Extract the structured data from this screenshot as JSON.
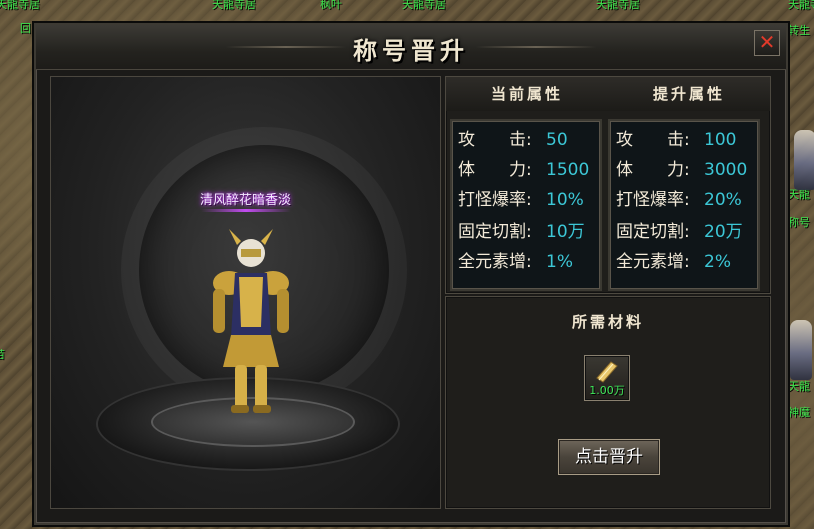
{
  "background": {
    "names": [
      "天龍寺居",
      "天龍寺居",
      "枫叶",
      "天龍寺居",
      "天龍寺居",
      "天龍寺居",
      "转生",
      "天龍",
      "称号",
      "天龍",
      "神魔",
      "回",
      "苗"
    ]
  },
  "window": {
    "title": "称号晋升",
    "close_icon": "close-x-icon"
  },
  "preview": {
    "character_title": "清风醉花暗香淡"
  },
  "current_attrs": {
    "header": "当前属性",
    "rows": [
      {
        "label": "攻　　击:",
        "value": "50"
      },
      {
        "label": "体　　力:",
        "value": "1500"
      },
      {
        "label": "打怪爆率:",
        "value": "10%"
      },
      {
        "label": "固定切割:",
        "value": "10万"
      },
      {
        "label": "全元素增:",
        "value": "1%"
      }
    ]
  },
  "upgrade_attrs": {
    "header": "提升属性",
    "rows": [
      {
        "label": "攻　　击:",
        "value": "100"
      },
      {
        "label": "体　　力:",
        "value": "3000"
      },
      {
        "label": "打怪爆率:",
        "value": "20%"
      },
      {
        "label": "固定切割:",
        "value": "20万"
      },
      {
        "label": "全元素增:",
        "value": "2%"
      }
    ]
  },
  "materials": {
    "header": "所需材料",
    "item_icon": "scroll-icon",
    "item_count": "1.00万"
  },
  "upgrade_button": "点击晋升",
  "colors": {
    "value": "#3cc7d6",
    "label": "#f3ead8",
    "item_count": "#3fe85a",
    "close": "#e23a2a"
  }
}
